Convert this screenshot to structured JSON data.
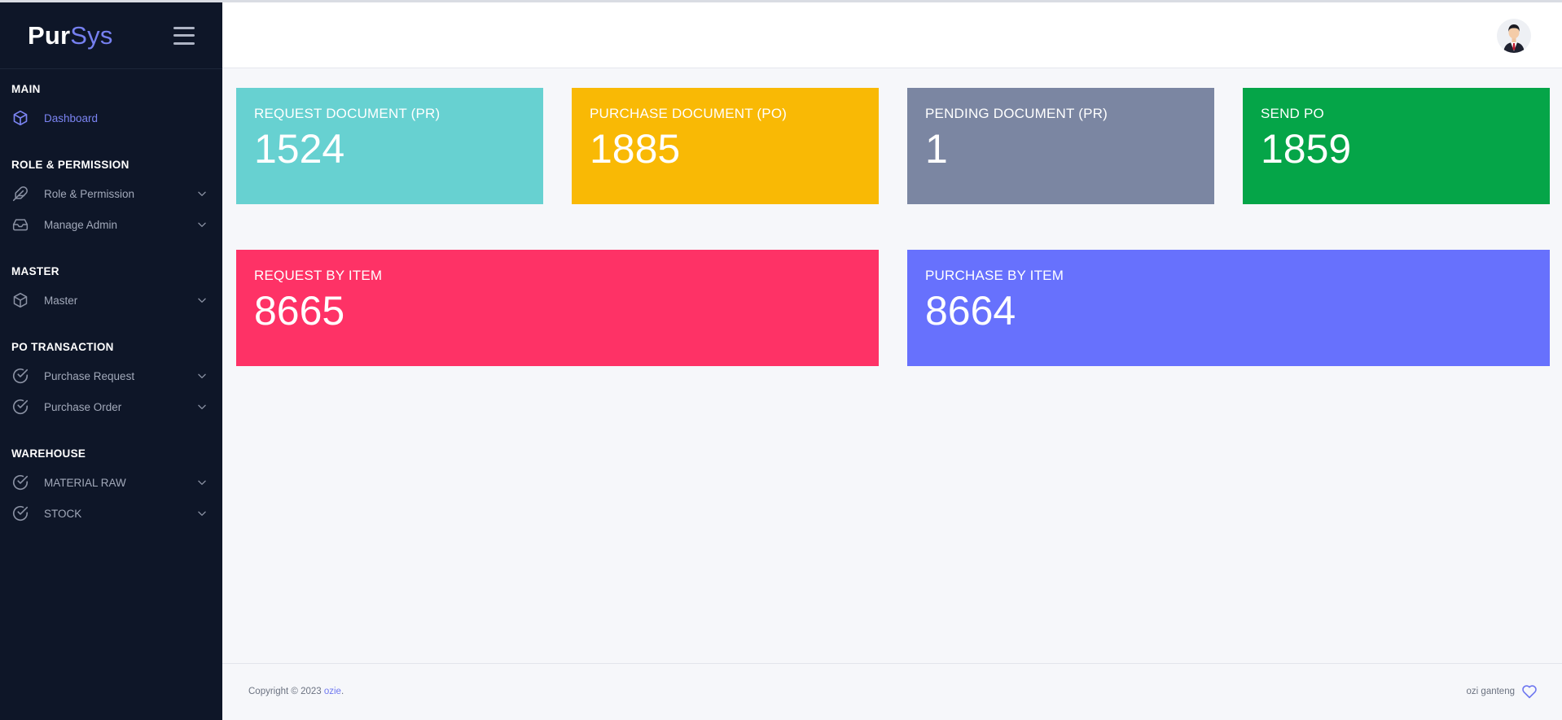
{
  "app": {
    "logo_main": "Pur",
    "logo_accent": "Sys"
  },
  "sidebar": {
    "sections": [
      {
        "title": "MAIN"
      },
      {
        "title": "ROLE & PERMISSION"
      },
      {
        "title": "MASTER"
      },
      {
        "title": "PO TRANSACTION"
      },
      {
        "title": "WAREHOUSE"
      }
    ],
    "items": [
      {
        "label": "Dashboard",
        "icon": "cube-icon",
        "active": true
      },
      {
        "label": "Role & Permission",
        "icon": "feather-icon"
      },
      {
        "label": "Manage Admin",
        "icon": "inbox-icon"
      },
      {
        "label": "Master",
        "icon": "box-icon"
      },
      {
        "label": "Purchase Request",
        "icon": "check-circle-icon"
      },
      {
        "label": "Purchase Order",
        "icon": "check-circle-icon"
      },
      {
        "label": "MATERIAL RAW",
        "icon": "check-circle-icon"
      },
      {
        "label": "STOCK",
        "icon": "check-circle-icon"
      }
    ]
  },
  "cards": [
    {
      "title": "REQUEST DOCUMENT (PR)",
      "value": "1524",
      "color": "#67d1d1"
    },
    {
      "title": "PURCHASE DOCUMENT (PO)",
      "value": "1885",
      "color": "#f9b905"
    },
    {
      "title": "PENDING DOCUMENT (PR)",
      "value": "1",
      "color": "#7b86a2"
    },
    {
      "title": "SEND PO",
      "value": "1859",
      "color": "#05a548"
    },
    {
      "title": "REQUEST BY ITEM",
      "value": "8665",
      "color": "#fe3266"
    },
    {
      "title": "PURCHASE BY ITEM",
      "value": "8664",
      "color": "#6771fd"
    }
  ],
  "footer": {
    "copyright_prefix": "Copyright © 2023 ",
    "copyright_link": "ozie",
    "copyright_suffix": ".",
    "credit": "ozi ganteng"
  },
  "colors": {
    "sidebar_bg": "#0e1628",
    "accent": "#7680f0"
  }
}
